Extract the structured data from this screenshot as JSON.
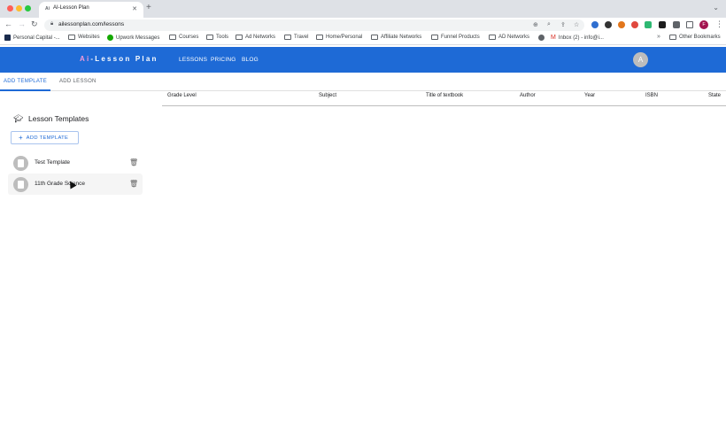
{
  "browser": {
    "tab_title": "AI-Lesson Plan",
    "tab_favicon": "Ai",
    "url": "ailessonplan.com/lessons",
    "profile_initial": "F",
    "bookmarks": [
      "Personal Capital -...",
      "Websites",
      "Upwork Messages",
      "Courses",
      "Tools",
      "Ad Networks",
      "Travel",
      "Home/Personal",
      "Affiliate Networks",
      "Funnel Products",
      "AD Networks",
      "Inbox (2) - info@i..."
    ],
    "other_bookmarks": "Other Bookmarks"
  },
  "app": {
    "logo_prefix": "Ai",
    "logo_suffix": "-Lesson Plan",
    "nav": [
      "LESSONS",
      "PRICING",
      "BLOG"
    ],
    "avatar_initial": "A"
  },
  "subtabs": [
    "ADD TEMPLATE",
    "ADD LESSON"
  ],
  "panel": {
    "title": "Lesson Templates",
    "add_button": "ADD TEMPLATE",
    "templates": [
      "Test Template",
      "11th Grade Science"
    ]
  },
  "table": {
    "columns": [
      "Grade Level",
      "Subject",
      "Title of textbook",
      "Author",
      "Year",
      "ISBN",
      "State"
    ]
  },
  "colors": {
    "brand_blue": "#1e6ad6",
    "logo_accent": "#f49ad8"
  }
}
